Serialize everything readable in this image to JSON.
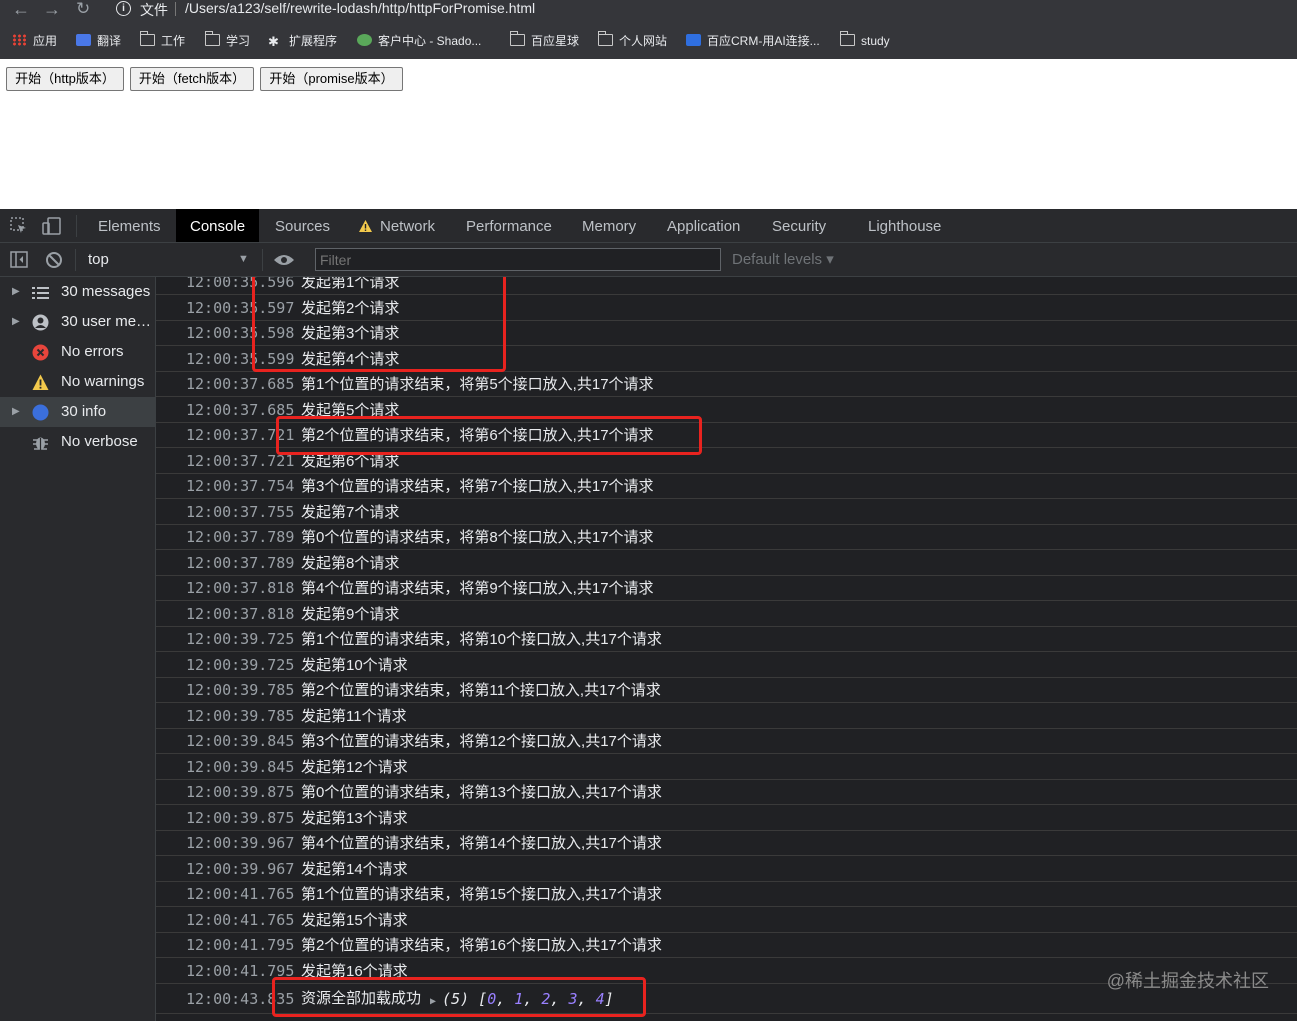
{
  "browser": {
    "file_label": "文件",
    "url": "/Users/a123/self/rewrite-lodash/http/httpForPromise.html",
    "bookmarks": [
      "应用",
      "翻译",
      "工作",
      "学习",
      "扩展程序",
      "客户中心 - Shado...",
      "百应星球",
      "个人网站",
      "百应CRM-用AI连接...",
      "study"
    ]
  },
  "page": {
    "buttons": [
      "开始（http版本）",
      "开始（fetch版本）",
      "开始（promise版本）"
    ]
  },
  "devtools": {
    "tabs": [
      "Elements",
      "Console",
      "Sources",
      "Network",
      "Performance",
      "Memory",
      "Application",
      "Security",
      "Lighthouse"
    ],
    "active_tab": "Console",
    "context": "top",
    "filter_placeholder": "Filter",
    "levels": "Default levels ▾",
    "sidebar": [
      {
        "label": "30 messages",
        "icon": "list-icon"
      },
      {
        "label": "30 user me…",
        "icon": "user-icon"
      },
      {
        "label": "No errors",
        "icon": "error-icon"
      },
      {
        "label": "No warnings",
        "icon": "warning-icon"
      },
      {
        "label": "30 info",
        "icon": "info-icon"
      },
      {
        "label": "No verbose",
        "icon": "bug-icon"
      }
    ],
    "log": [
      {
        "time": "12:00:35.596",
        "msg": "发起第1个请求"
      },
      {
        "time": "12:00:35.597",
        "msg": "发起第2个请求"
      },
      {
        "time": "12:00:35.598",
        "msg": "发起第3个请求"
      },
      {
        "time": "12:00:35.599",
        "msg": "发起第4个请求"
      },
      {
        "time": "12:00:37.685",
        "msg": "第1个位置的请求结束，将第5个接口放入,共17个请求"
      },
      {
        "time": "12:00:37.685",
        "msg": "发起第5个请求"
      },
      {
        "time": "12:00:37.721",
        "msg": "第2个位置的请求结束，将第6个接口放入,共17个请求"
      },
      {
        "time": "12:00:37.721",
        "msg": "发起第6个请求"
      },
      {
        "time": "12:00:37.754",
        "msg": "第3个位置的请求结束，将第7个接口放入,共17个请求"
      },
      {
        "time": "12:00:37.755",
        "msg": "发起第7个请求"
      },
      {
        "time": "12:00:37.789",
        "msg": "第0个位置的请求结束，将第8个接口放入,共17个请求"
      },
      {
        "time": "12:00:37.789",
        "msg": "发起第8个请求"
      },
      {
        "time": "12:00:37.818",
        "msg": "第4个位置的请求结束，将第9个接口放入,共17个请求"
      },
      {
        "time": "12:00:37.818",
        "msg": "发起第9个请求"
      },
      {
        "time": "12:00:39.725",
        "msg": "第1个位置的请求结束，将第10个接口放入,共17个请求"
      },
      {
        "time": "12:00:39.725",
        "msg": "发起第10个请求"
      },
      {
        "time": "12:00:39.785",
        "msg": "第2个位置的请求结束，将第11个接口放入,共17个请求"
      },
      {
        "time": "12:00:39.785",
        "msg": "发起第11个请求"
      },
      {
        "time": "12:00:39.845",
        "msg": "第3个位置的请求结束，将第12个接口放入,共17个请求"
      },
      {
        "time": "12:00:39.845",
        "msg": "发起第12个请求"
      },
      {
        "time": "12:00:39.875",
        "msg": "第0个位置的请求结束，将第13个接口放入,共17个请求"
      },
      {
        "time": "12:00:39.875",
        "msg": "发起第13个请求"
      },
      {
        "time": "12:00:39.967",
        "msg": "第4个位置的请求结束，将第14个接口放入,共17个请求"
      },
      {
        "time": "12:00:39.967",
        "msg": "发起第14个请求"
      },
      {
        "time": "12:00:41.765",
        "msg": "第1个位置的请求结束，将第15个接口放入,共17个请求"
      },
      {
        "time": "12:00:41.765",
        "msg": "发起第15个请求"
      },
      {
        "time": "12:00:41.795",
        "msg": "第2个位置的请求结束，将第16个接口放入,共17个请求"
      },
      {
        "time": "12:00:41.795",
        "msg": "发起第16个请求"
      },
      {
        "time": "12:00:43.835",
        "msg": "资源全部加载成功"
      }
    ],
    "result_array": {
      "count": "(5)",
      "values": [
        "0",
        "1",
        "2",
        "3",
        "4"
      ]
    }
  },
  "watermark": "@稀土掘金技术社区",
  "colors": {
    "highlight": "#e8231f",
    "number": "#9980ff",
    "devtools_bg": "#202124"
  }
}
